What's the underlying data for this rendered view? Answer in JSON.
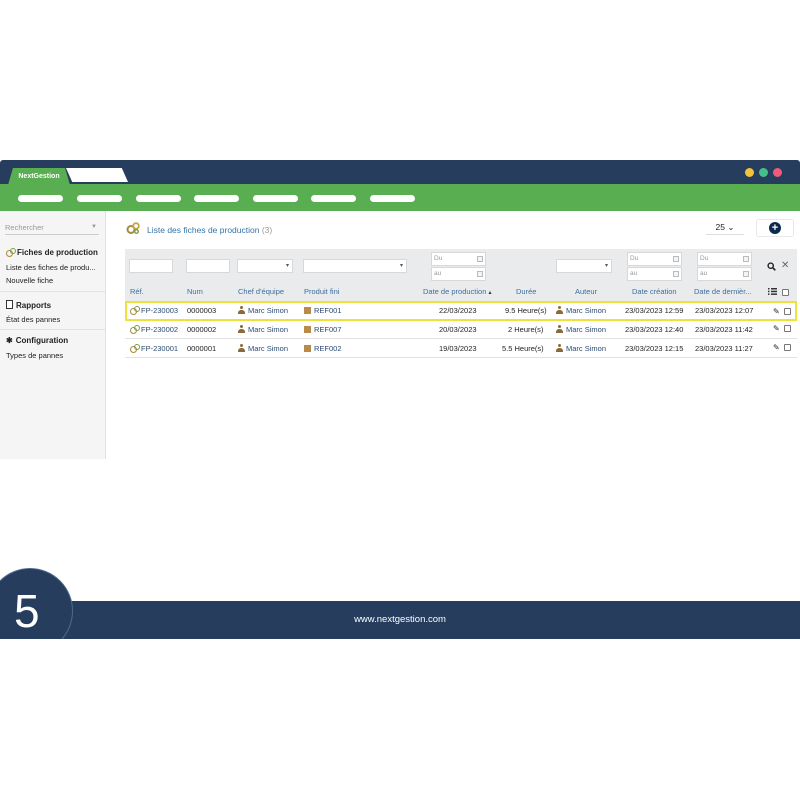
{
  "browser": {
    "active_tab_label": "NextGestion",
    "window_dots": [
      "#f0c33a",
      "#43c08a",
      "#ef5a78"
    ]
  },
  "sidebar": {
    "search_placeholder": "Rechercher",
    "sections": [
      {
        "title": "Fiches de production",
        "icon": "gears-icon",
        "links": [
          "Liste des fiches de produ...",
          "Nouvelle fiche"
        ]
      },
      {
        "title": "Rapports",
        "icon": "report-icon",
        "links": [
          "État des pannes"
        ]
      },
      {
        "title": "Configuration",
        "icon": "gear-icon",
        "links": [
          "Types de pannes"
        ]
      }
    ]
  },
  "main": {
    "title": "Liste des fiches de production",
    "count": "(3)",
    "per_page": "25"
  },
  "filters": {
    "date_from_placeholder": "Du",
    "date_to_placeholder": "au"
  },
  "table": {
    "columns": [
      "Réf.",
      "Num",
      "Chef d'équipe",
      "Produit fini",
      "Date de production",
      "Durée",
      "Auteur",
      "Date création",
      "Date de dernièr..."
    ],
    "sort_indicator": "▴",
    "rows": [
      {
        "ref": "FP-230003",
        "num": "0000003",
        "chef": "Marc Simon",
        "produit": "REF001",
        "date_prod": "22/03/2023",
        "duree": "9.5 Heure(s)",
        "auteur": "Marc Simon",
        "date_creation": "23/03/2023 12:59",
        "date_modif": "23/03/2023 12:07",
        "highlighted": true
      },
      {
        "ref": "FP-230002",
        "num": "0000002",
        "chef": "Marc Simon",
        "produit": "REF007",
        "date_prod": "20/03/2023",
        "duree": "2 Heure(s)",
        "auteur": "Marc Simon",
        "date_creation": "23/03/2023 12:40",
        "date_modif": "23/03/2023 11:42",
        "highlighted": false
      },
      {
        "ref": "FP-230001",
        "num": "0000001",
        "chef": "Marc Simon",
        "produit": "REF002",
        "date_prod": "19/03/2023",
        "duree": "5.5 Heure(s)",
        "auteur": "Marc Simon",
        "date_creation": "23/03/2023 12:15",
        "date_modif": "23/03/2023 11:27",
        "highlighted": false
      }
    ]
  },
  "footer": {
    "url": "www.nextgestion.com",
    "step": "5"
  },
  "colors": {
    "navy": "#263d5e",
    "green": "#5aae52",
    "highlight": "#efe13b",
    "link": "#3474a8"
  }
}
